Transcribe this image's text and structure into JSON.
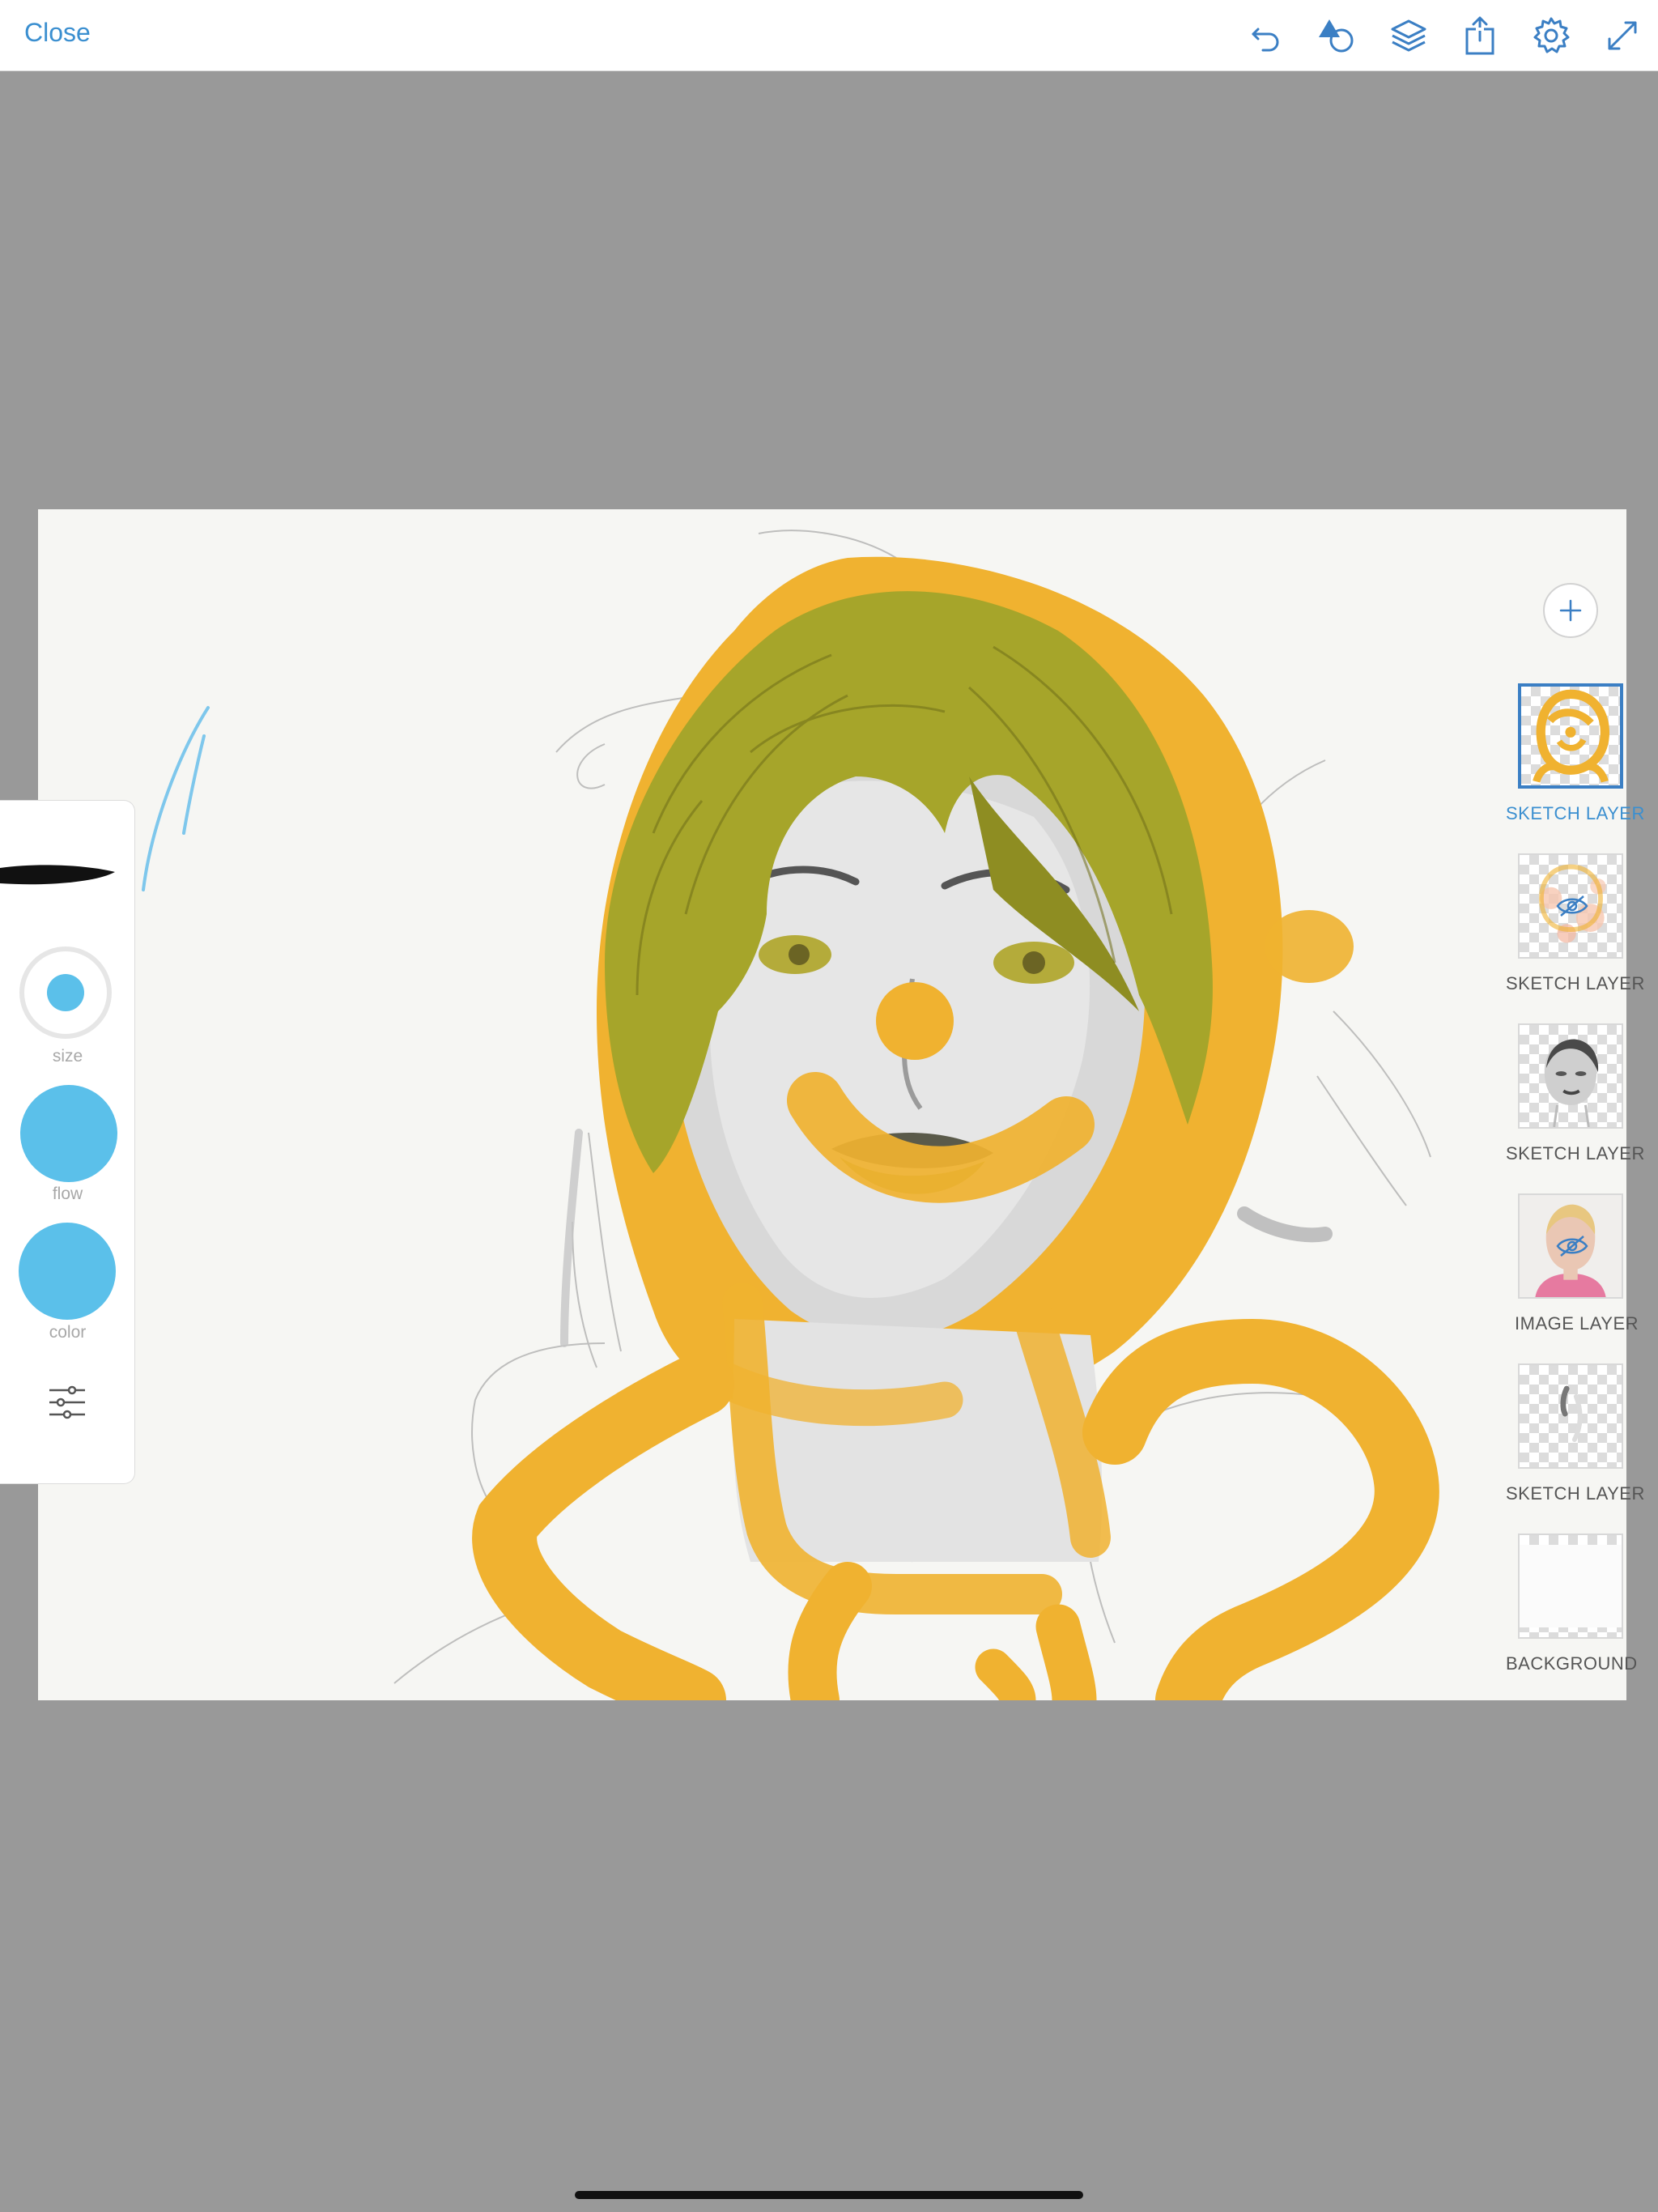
{
  "topbar": {
    "close_label": "Close",
    "icons": [
      "undo-icon",
      "shapes-icon",
      "layers-icon",
      "share-icon",
      "settings-icon",
      "fullscreen-icon"
    ]
  },
  "brush_panel": {
    "size_label": "size",
    "flow_label": "flow",
    "color_label": "color",
    "accent_color": "#5bc0ea"
  },
  "layers": {
    "add_icon": "plus-icon",
    "items": [
      {
        "label": "SKETCH LAYER",
        "selected": true,
        "hidden": false
      },
      {
        "label": "SKETCH LAYER",
        "selected": false,
        "hidden": true
      },
      {
        "label": "SKETCH LAYER",
        "selected": false,
        "hidden": false
      },
      {
        "label": "IMAGE LAYER",
        "selected": false,
        "hidden": true
      },
      {
        "label": "SKETCH LAYER",
        "selected": false,
        "hidden": false
      },
      {
        "label": "BACKGROUND",
        "selected": false,
        "hidden": false
      }
    ]
  },
  "colors": {
    "accent": "#3b8fd0",
    "paint_yellow": "#f0b230",
    "hair_olive": "#a6a52a",
    "canvas_bg": "#f6f6f3",
    "workspace_bg": "#999999"
  }
}
